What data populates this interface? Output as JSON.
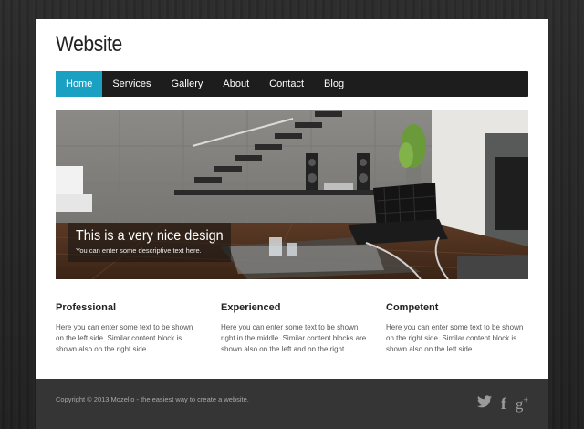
{
  "site": {
    "title": "Website"
  },
  "nav": {
    "items": [
      {
        "label": "Home",
        "active": true
      },
      {
        "label": "Services",
        "active": false
      },
      {
        "label": "Gallery",
        "active": false
      },
      {
        "label": "About",
        "active": false
      },
      {
        "label": "Contact",
        "active": false
      },
      {
        "label": "Blog",
        "active": false
      }
    ]
  },
  "hero": {
    "image": "interior-living-room-photo",
    "caption_title": "This is a very nice design",
    "caption_text": "You can enter some descriptive text here."
  },
  "columns": [
    {
      "title": "Professional",
      "text": "Here you can enter some text to be shown on the left side. Similar content block is shown also on the right side."
    },
    {
      "title": "Experienced",
      "text": "Here you can enter some text to be shown right in the middle. Similar content blocks are shown also on the left and on the right."
    },
    {
      "title": "Competent",
      "text": "Here you can enter some text to be shown on the right side. Similar content block is shown also on the left side."
    }
  ],
  "footer": {
    "copyright": "Copyright © 2013 Mozello - the easiest way to create a website.",
    "social": [
      "twitter-icon",
      "facebook-icon",
      "google-plus-icon"
    ]
  },
  "colors": {
    "accent": "#1aa0c2",
    "nav_bg": "#1d1d1d",
    "footer_bg": "#353535"
  }
}
